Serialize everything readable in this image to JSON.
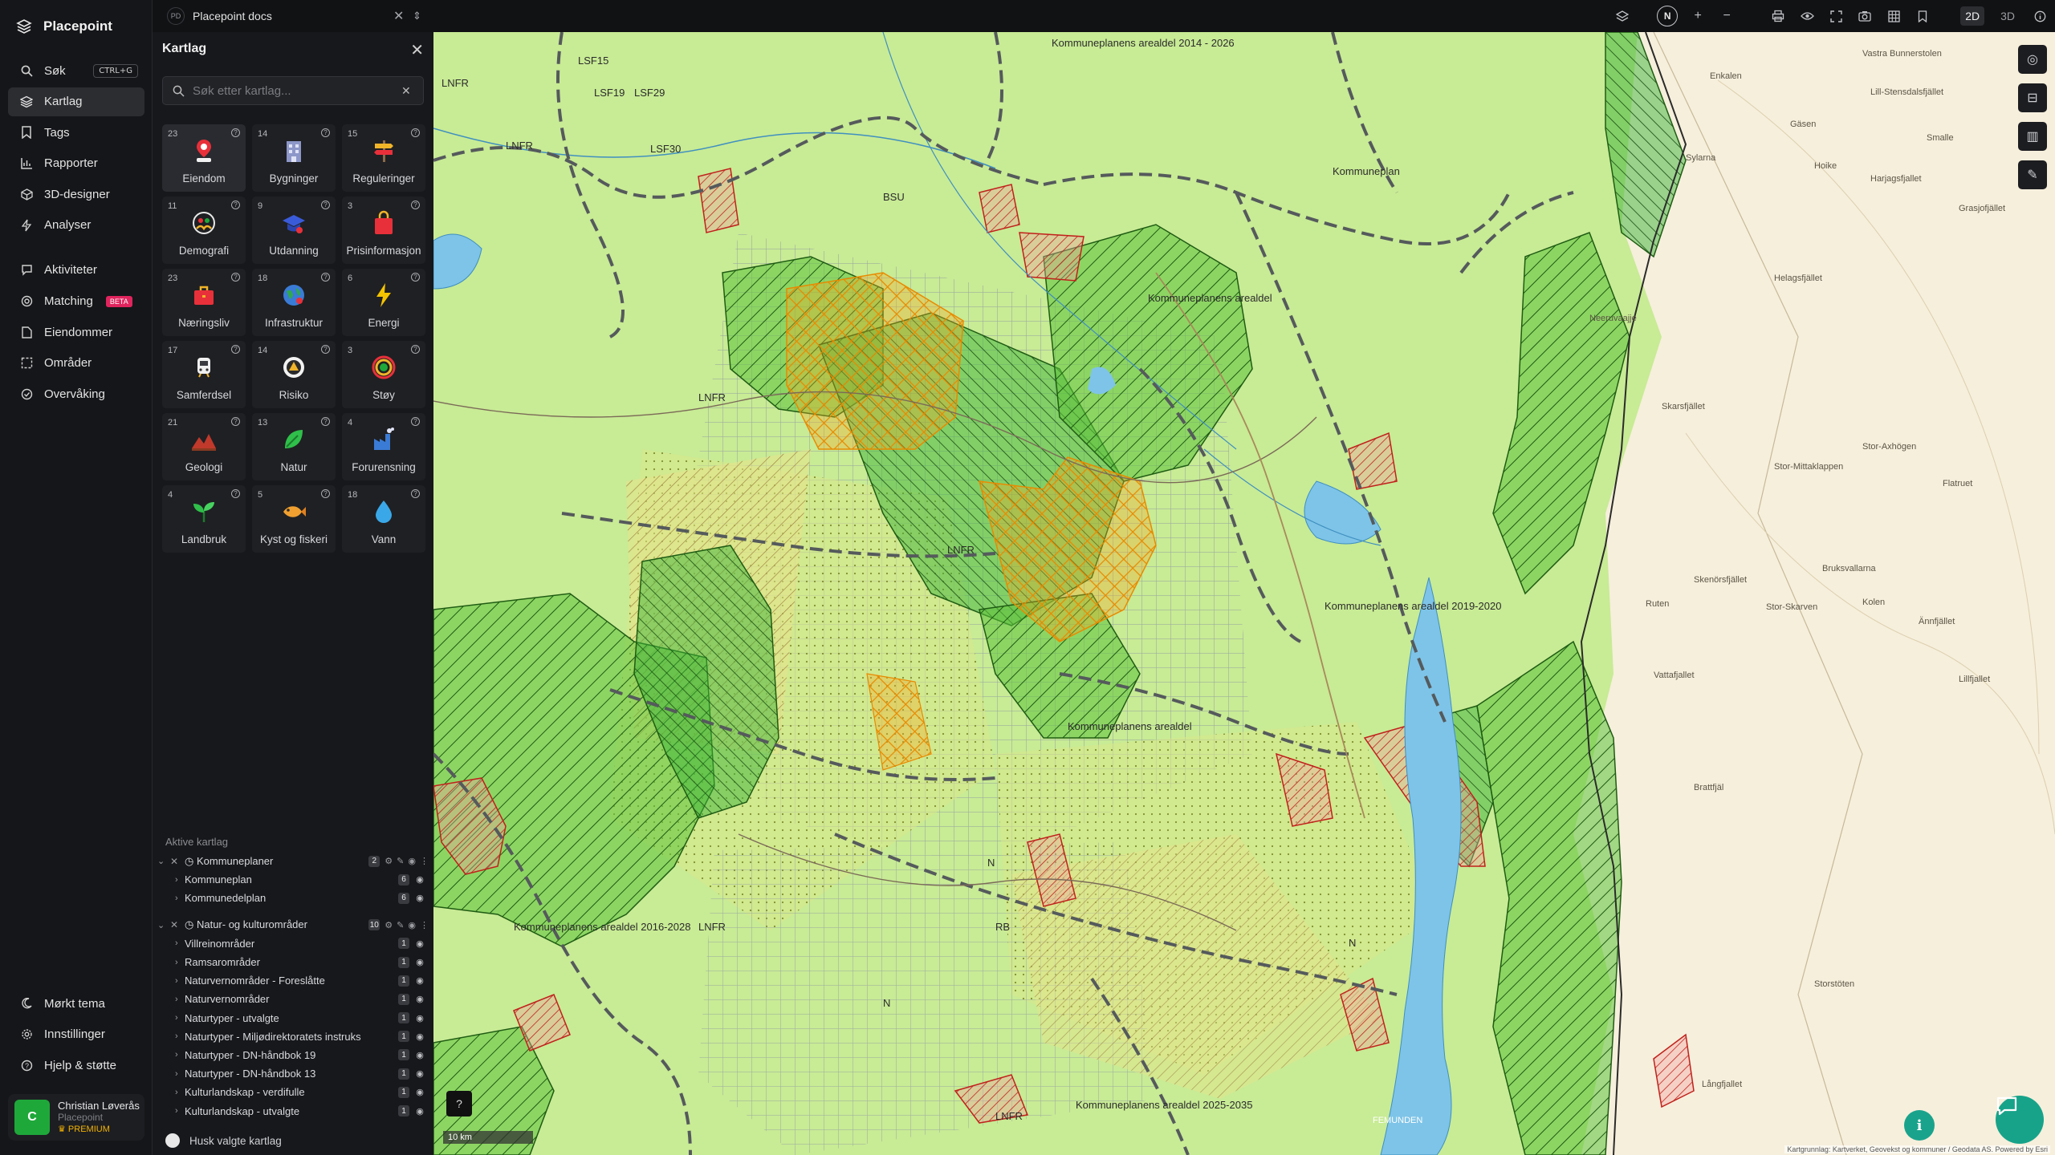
{
  "app": {
    "name": "Placepoint"
  },
  "nav": {
    "items": [
      {
        "label": "Søk",
        "shortcut": "CTRL+G",
        "icon": "search-icon"
      },
      {
        "label": "Kartlag",
        "icon": "layers-icon",
        "active": true
      },
      {
        "label": "Tags",
        "icon": "bookmark-icon"
      },
      {
        "label": "Rapporter",
        "icon": "chart-icon"
      },
      {
        "label": "3D-designer",
        "icon": "cube-icon"
      },
      {
        "label": "Analyser",
        "icon": "bolt-icon"
      }
    ],
    "items2": [
      {
        "label": "Aktiviteter",
        "icon": "chat-icon"
      },
      {
        "label": "Matching",
        "badge": "BETA",
        "icon": "target-icon"
      },
      {
        "label": "Eiendommer",
        "icon": "document-icon"
      },
      {
        "label": "Områder",
        "icon": "area-icon"
      },
      {
        "label": "Overvåking",
        "icon": "check-circle-icon"
      }
    ],
    "bottom": [
      {
        "label": "Mørkt tema",
        "icon": "moon-icon"
      },
      {
        "label": "Innstillinger",
        "icon": "gear-icon"
      },
      {
        "label": "Hjelp & støtte",
        "icon": "help-icon"
      }
    ]
  },
  "user": {
    "initial": "C",
    "name": "Christian Løverås",
    "org": "Placepoint",
    "plan": "PREMIUM"
  },
  "topbar": {
    "doc_badge": "PD",
    "doc_title": "Placepoint docs",
    "north": "N",
    "mode_2d": "2D",
    "mode_3d": "3D"
  },
  "panel": {
    "title": "Kartlag",
    "search_placeholder": "Søk etter kartlag...",
    "categories": [
      {
        "count": "23",
        "label": "Eiendom",
        "icon": "property-pin-icon",
        "selected": true
      },
      {
        "count": "14",
        "label": "Bygninger",
        "icon": "building-icon"
      },
      {
        "count": "15",
        "label": "Reguleringer",
        "icon": "signpost-icon"
      },
      {
        "count": "11",
        "label": "Demografi",
        "icon": "people-icon"
      },
      {
        "count": "9",
        "label": "Utdanning",
        "icon": "graduation-cap-icon"
      },
      {
        "count": "3",
        "label": "Prisinformasjon",
        "icon": "shopping-bag-icon"
      },
      {
        "count": "23",
        "label": "Næringsliv",
        "icon": "briefcase-icon"
      },
      {
        "count": "18",
        "label": "Infrastruktur",
        "icon": "globe-icon"
      },
      {
        "count": "6",
        "label": "Energi",
        "icon": "lightning-icon"
      },
      {
        "count": "17",
        "label": "Samferdsel",
        "icon": "train-icon"
      },
      {
        "count": "14",
        "label": "Risiko",
        "icon": "warning-icon"
      },
      {
        "count": "3",
        "label": "Støy",
        "icon": "noise-icon"
      },
      {
        "count": "21",
        "label": "Geologi",
        "icon": "mountains-icon"
      },
      {
        "count": "13",
        "label": "Natur",
        "icon": "leaf-icon"
      },
      {
        "count": "4",
        "label": "Forurensning",
        "icon": "factory-icon"
      },
      {
        "count": "4",
        "label": "Landbruk",
        "icon": "plant-icon"
      },
      {
        "count": "5",
        "label": "Kyst og fiskeri",
        "icon": "fish-icon"
      },
      {
        "count": "18",
        "label": "Vann",
        "icon": "water-drop-icon"
      }
    ],
    "active_header": "Aktive kartlag",
    "groups": [
      {
        "label": "Kommuneplaner",
        "count": "2",
        "children": [
          {
            "label": "Kommuneplan",
            "count": "6"
          },
          {
            "label": "Kommunedelplan",
            "count": "6"
          }
        ]
      },
      {
        "label": "Natur- og kulturområder",
        "count": "10",
        "children": [
          {
            "label": "Villreinområder",
            "count": "1"
          },
          {
            "label": "Ramsarområder",
            "count": "1"
          },
          {
            "label": "Naturvernområder - Foreslåtte",
            "count": "1"
          },
          {
            "label": "Naturvernområder",
            "count": "1"
          },
          {
            "label": "Naturtyper - utvalgte",
            "count": "1"
          },
          {
            "label": "Naturtyper - Miljødirektoratets instruks",
            "count": "1"
          },
          {
            "label": "Naturtyper - DN-håndbok 19",
            "count": "1"
          },
          {
            "label": "Naturtyper - DN-håndbok 13",
            "count": "1"
          },
          {
            "label": "Kulturlandskap - verdifulle",
            "count": "1"
          },
          {
            "label": "Kulturlandskap - utvalgte",
            "count": "1"
          }
        ]
      }
    ],
    "remember_label": "Husk valgte kartlag"
  },
  "map": {
    "scale": "10 km",
    "attribution": "Kartgrunnlag: Kartverket, Geovekst og kommuner / Geodata AS. Powered by Esri",
    "labels": [
      "Kommuneplanens arealdel 2014 - 2026",
      "Kommuneplan",
      "Kommuneplanens arealdel",
      "Kommuneplanens arealdel 2019-2020",
      "Kommuneplanens arealdel",
      "Kommuneplanens arealdel 2025-2035",
      "Kommuneplanens arealdel 2016-2028",
      "LNFR",
      "LNFR",
      "LNFR",
      "LNFR",
      "LNFR",
      "LNFR",
      "LSF15",
      "LSF19",
      "LSF29",
      "LSF30",
      "BSU",
      "RB",
      "N",
      "N",
      "N",
      "FEMUNDEN"
    ],
    "places": [
      "Vastra Bunnerstolen",
      "Enkalen",
      "Lill-Stensdalsfjället",
      "Gäsen",
      "Hoike",
      "Sylarna",
      "Smalle",
      "Harjagsfjallet",
      "Grasjofjället",
      "Helagsfjället",
      "Neeruvaajje",
      "Skarsfjället",
      "Stor-Mittaklappen",
      "Stor-Axhögen",
      "Flatruet",
      "Skenörsfjället",
      "Bruksvallarna",
      "Stor-Skarven",
      "Kolen",
      "Ännfjället",
      "Ruten",
      "Lillfjallet",
      "Vattafjallet",
      "Brattfjäl",
      "Storstöten",
      "Långfjallet"
    ]
  }
}
